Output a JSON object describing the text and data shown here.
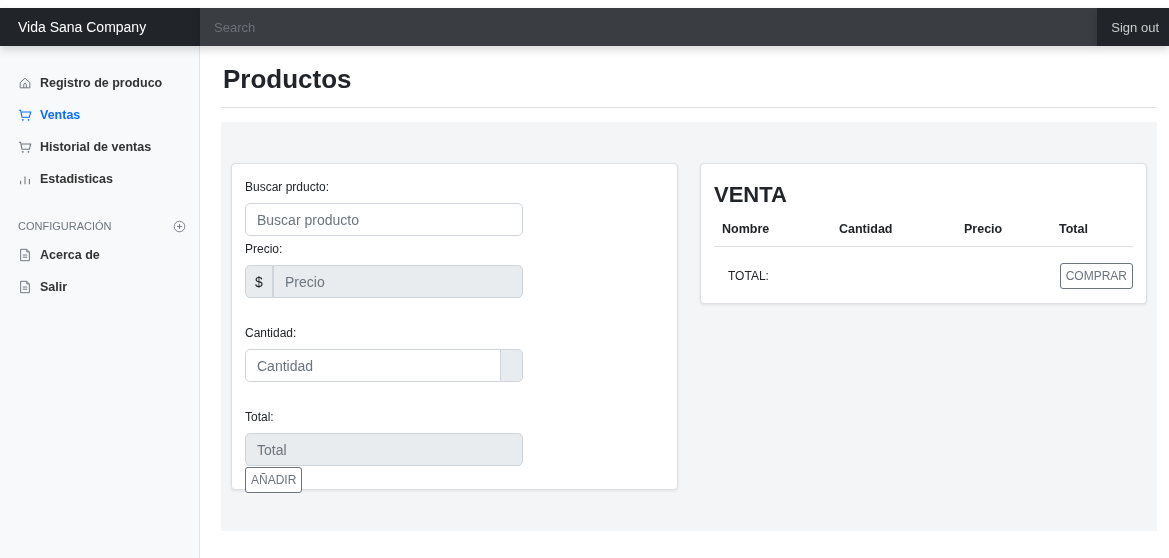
{
  "navbar": {
    "brand": "Vida Sana Company",
    "search": {
      "placeholder": "Search"
    },
    "sign_out": "Sign out"
  },
  "sidebar": {
    "items": [
      {
        "label": "Registro de produco",
        "selected": false
      },
      {
        "label": "Ventas",
        "selected": true
      },
      {
        "label": "Historial de ventas",
        "selected": false
      },
      {
        "label": "Estadisticas",
        "selected": false
      }
    ],
    "section": {
      "heading": "CONFIGURACIÓN",
      "items": [
        {
          "label": "Acerca de",
          "selected": false
        },
        {
          "label": "Salir",
          "selected": false
        }
      ]
    }
  },
  "page_title": "Productos",
  "form": {
    "fields": [
      {
        "kind": "text",
        "label": "Buscar prducto:",
        "placeholder": "Buscar producto",
        "disabled": false
      },
      {
        "kind": "prefixed",
        "label": "Precio:",
        "prefix": "$",
        "placeholder": "Precio",
        "disabled": true
      },
      {
        "kind": "suffixed",
        "label": "Cantidad:",
        "placeholder": "Cantidad",
        "disabled": false
      },
      {
        "kind": "text",
        "label": "Total:",
        "placeholder": "Total",
        "disabled": true
      }
    ],
    "button": "AÑADIR"
  },
  "sale": {
    "title": "VENTA",
    "columns": [
      "Nombre",
      "Cantidad",
      "Precio",
      "Total"
    ],
    "total_label": "TOTAL:",
    "button": "COMPRAR"
  }
}
